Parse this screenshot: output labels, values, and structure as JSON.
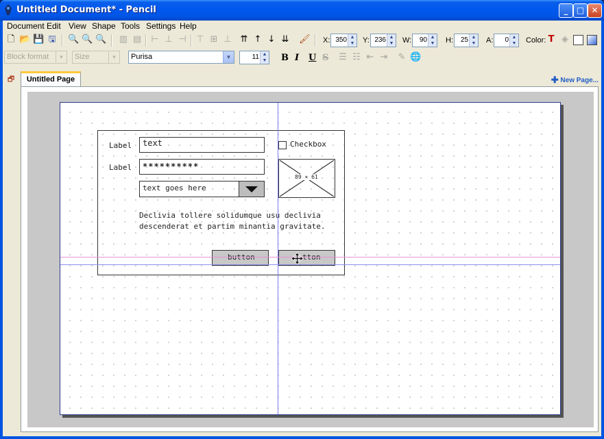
{
  "window": {
    "title": "Untitled Document* - Pencil"
  },
  "menu": [
    "Document",
    "Edit",
    "View",
    "Shape",
    "Tools",
    "Settings",
    "Help"
  ],
  "geometry_fields": [
    {
      "label": "X:",
      "value": "350"
    },
    {
      "label": "Y:",
      "value": "236"
    },
    {
      "label": "W:",
      "value": "90"
    },
    {
      "label": "H:",
      "value": "25"
    },
    {
      "label": "A:",
      "value": "0"
    }
  ],
  "color_label": "Color:",
  "format": {
    "block_format": "Block format",
    "size": "Size",
    "font": "Purisa",
    "font_size": "11",
    "bold": "B",
    "italic": "I",
    "underline": "U",
    "strike": "S"
  },
  "tabs": {
    "page": "Untitled Page",
    "new_page": "New Page..."
  },
  "mockup": {
    "label1": "Label",
    "label2": "Label",
    "text_value": "text",
    "password_value": "**********",
    "dropdown_value": "text goes here",
    "checkbox_label": "Checkbox",
    "image_caption": "89 × 61",
    "paragraph_line1": "Declivia tollere solidumque usu declivia",
    "paragraph_line2": "descenderat et partim minantia gravitate.",
    "button1": "button",
    "button2": "tton"
  }
}
